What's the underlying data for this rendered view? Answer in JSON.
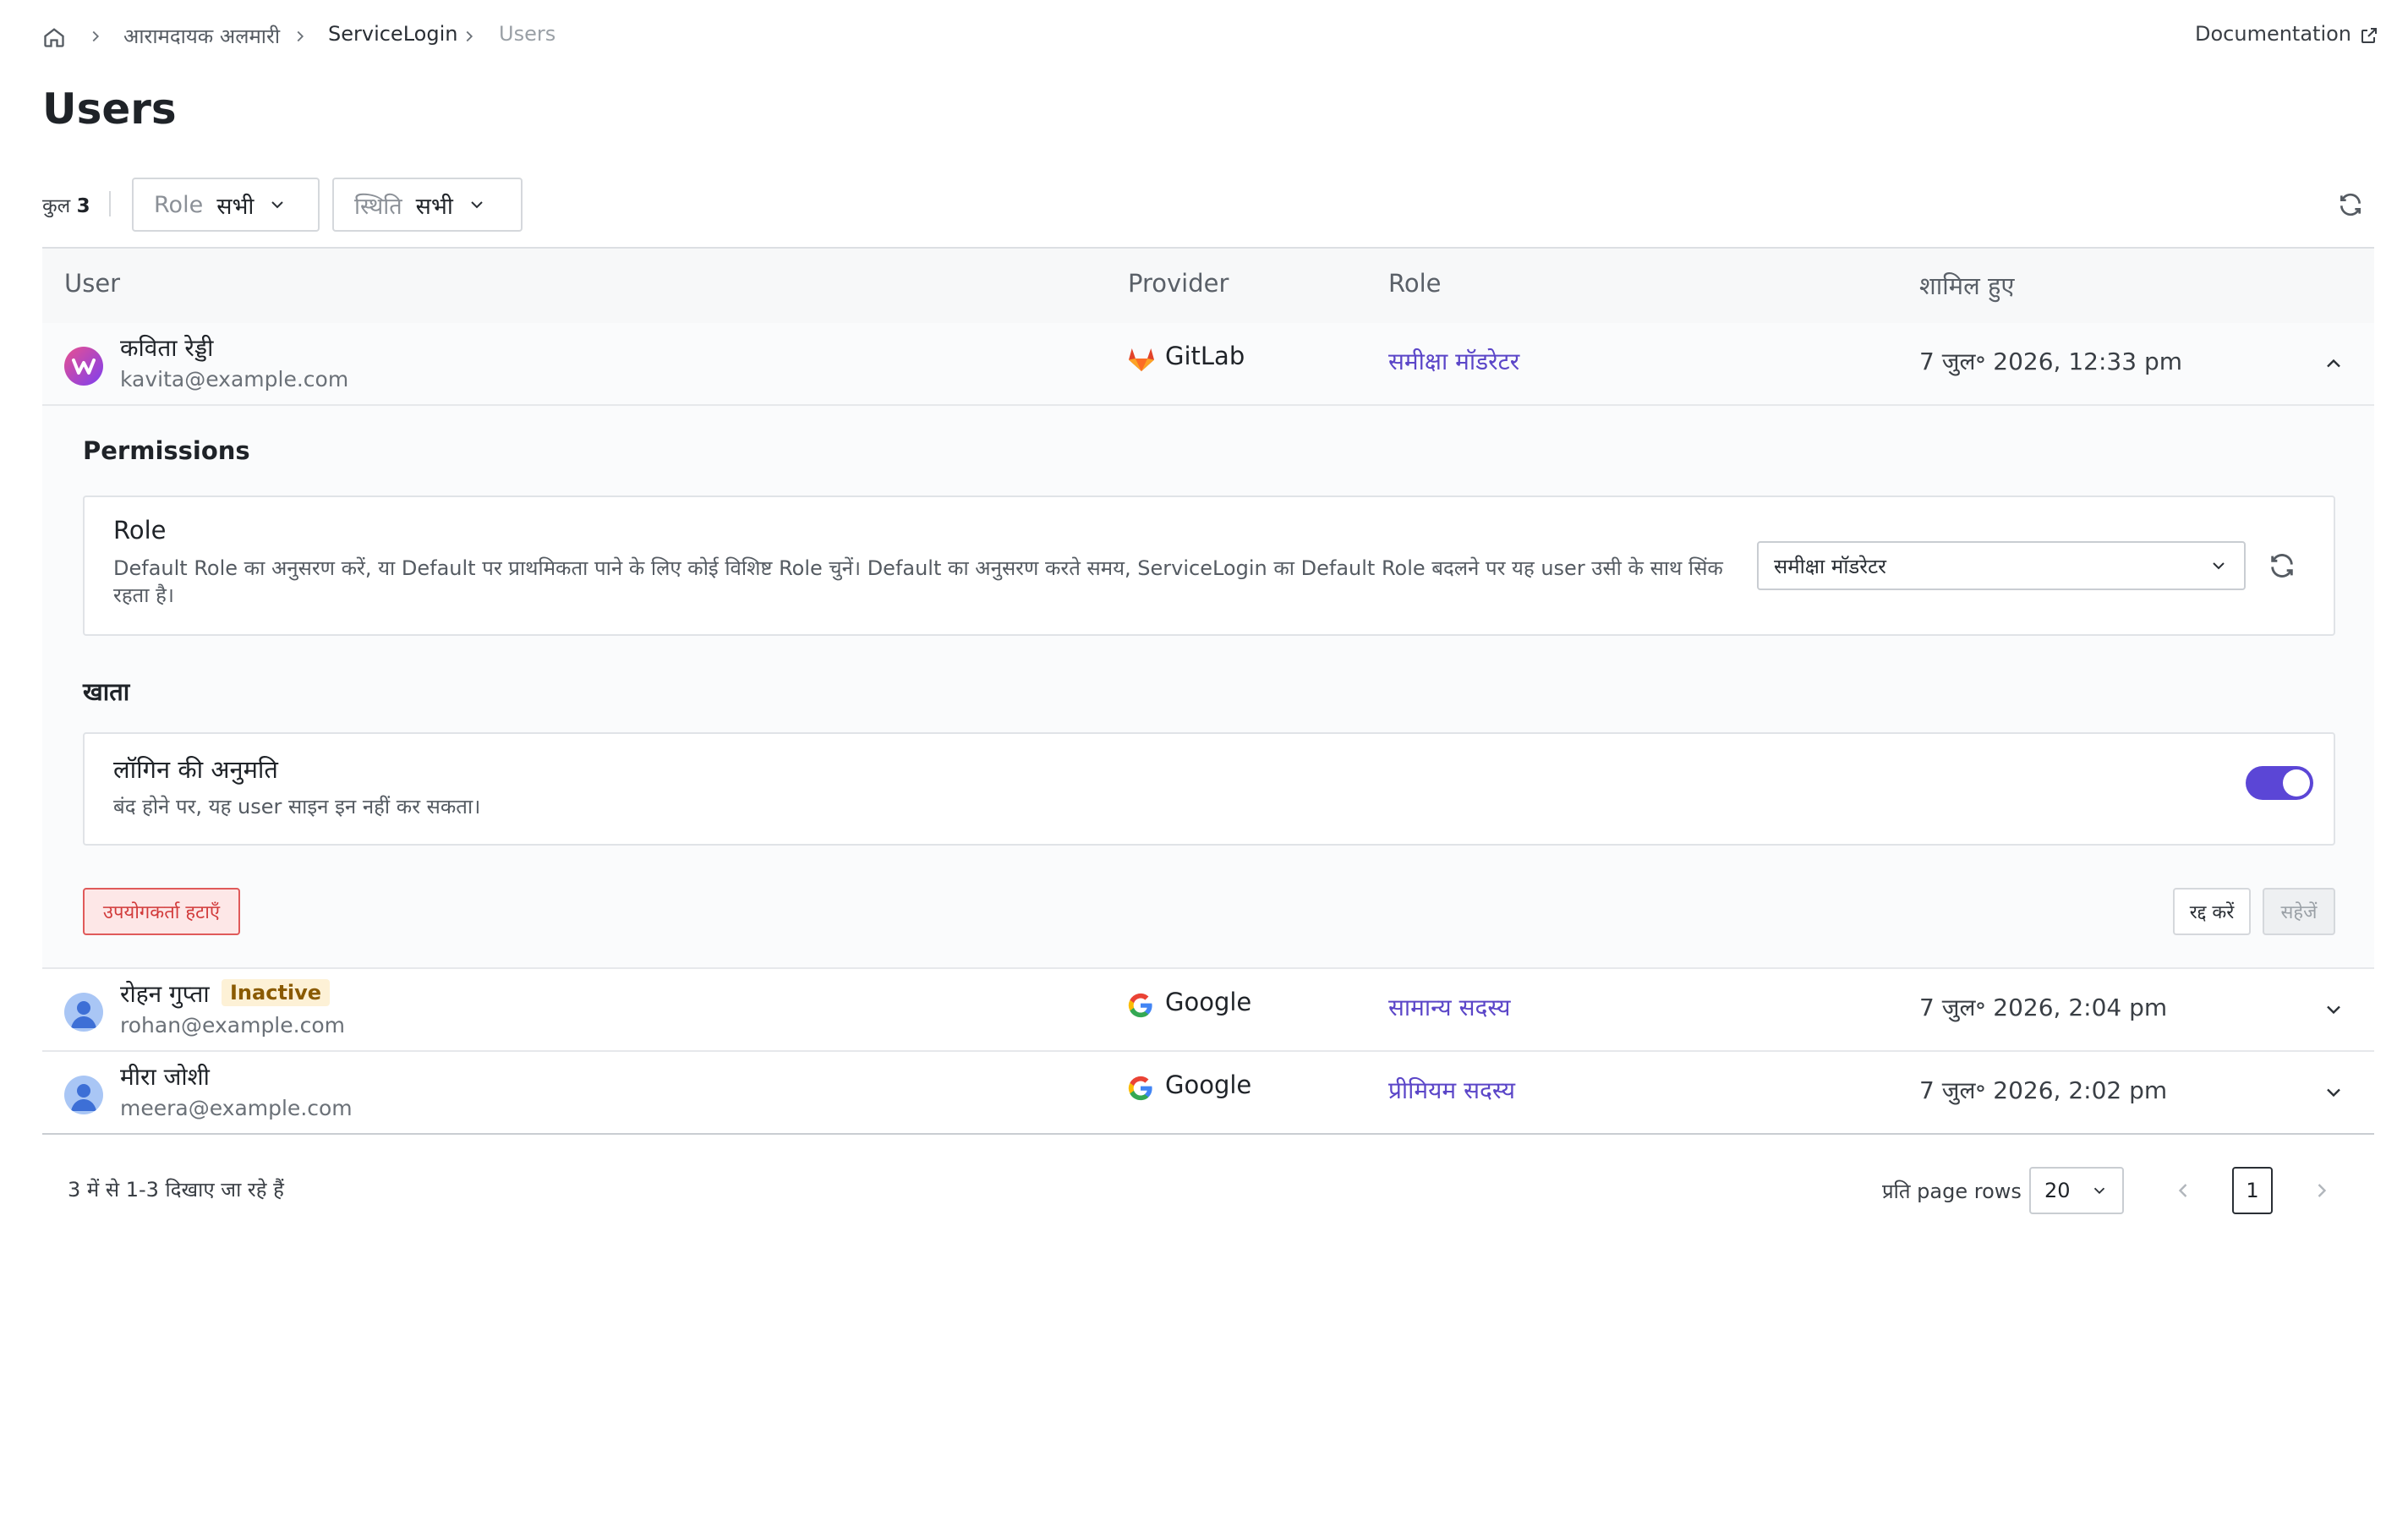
{
  "breadcrumb": {
    "items": [
      "आरामदायक अलमारी",
      "ServiceLogin",
      "Users"
    ],
    "documentation": "Documentation"
  },
  "page": {
    "title": "Users"
  },
  "filters": {
    "total_label": "कुल",
    "total_count": "3",
    "role_label": "Role",
    "role_value": "सभी",
    "status_label": "स्थिति",
    "status_value": "सभी"
  },
  "table": {
    "headers": [
      "User",
      "Provider",
      "Role",
      "शामिल हुए"
    ],
    "rows": [
      {
        "name": "कविता रेड्डी",
        "email": "kavita@example.com",
        "provider": "GitLab",
        "role": "समीक्षा मॉडरेटर",
        "joined": "7 जुल॰ 2026, 12:33 pm",
        "badge": ""
      },
      {
        "name": "रोहन गुप्ता",
        "email": "rohan@example.com",
        "provider": "Google",
        "role": "सामान्य सदस्य",
        "joined": "7 जुल॰ 2026, 2:04 pm",
        "badge": "Inactive"
      },
      {
        "name": "मीरा जोशी",
        "email": "meera@example.com",
        "provider": "Google",
        "role": "प्रीमियम सदस्य",
        "joined": "7 जुल॰ 2026, 2:02 pm",
        "badge": ""
      }
    ]
  },
  "expanded": {
    "permissions_title": "Permissions",
    "role_card_title": "Role",
    "role_card_desc": "Default Role का अनुसरण करें, या Default पर प्राथमिकता पाने के लिए कोई विशिष्ट Role चुनें। Default का अनुसरण करते समय, ServiceLogin का Default Role बदलने पर यह user उसी के साथ सिंक रहता है।",
    "role_select_value": "समीक्षा मॉडरेटर",
    "account_title": "खाता",
    "login_title": "लॉगिन की अनुमति",
    "login_desc": "बंद होने पर, यह user साइन इन नहीं कर सकता।",
    "login_enabled": true,
    "remove_label": "उपयोगकर्ता हटाएँ",
    "cancel_label": "रद्द करें",
    "save_label": "सहेजें"
  },
  "pagination": {
    "summary": "3 में से 1-3 दिखाए जा रहे हैं",
    "rows_per_page_label": "प्रति page rows",
    "rows_per_page_value": "20",
    "current_page": "1"
  },
  "colors": {
    "accent": "#5b46c8",
    "danger": "#d23b3b",
    "badge_bg": "#fdf1d6"
  }
}
